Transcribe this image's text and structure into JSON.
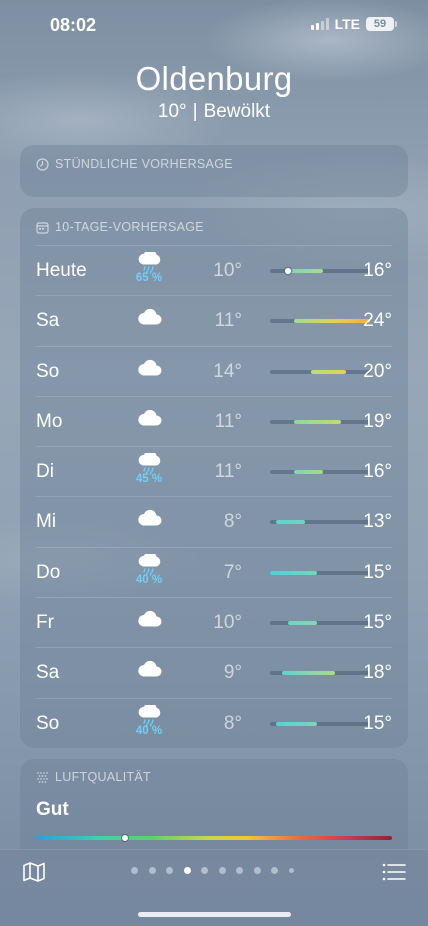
{
  "status_bar": {
    "time": "08:02",
    "network": "LTE",
    "battery": "59"
  },
  "header": {
    "city": "Oldenburg",
    "temperature": "10°",
    "separator": "|",
    "condition": "Bewölkt"
  },
  "hourly": {
    "title": "STÜNDLICHE VORHERSAGE",
    "icon": "clock-icon"
  },
  "daily": {
    "title": "10-TAGE-VORHERSAGE",
    "icon": "calendar-icon",
    "scale_min": 7,
    "scale_max": 24,
    "current_temp": 10,
    "days": [
      {
        "day": "Heute",
        "icon": "cloud-rain-icon",
        "precip": "65 %",
        "low": "10°",
        "high": "16°",
        "low_v": 10,
        "high_v": 16,
        "color": "linear-gradient(90deg,#7fd6b6,#a5dd84)"
      },
      {
        "day": "Sa",
        "icon": "cloud-icon",
        "precip": "",
        "low": "11°",
        "high": "24°",
        "low_v": 11,
        "high_v": 24,
        "color": "linear-gradient(90deg,#9fdc94,#e4d24f,#f2b233)"
      },
      {
        "day": "So",
        "icon": "cloud-icon",
        "precip": "",
        "low": "14°",
        "high": "20°",
        "low_v": 14,
        "high_v": 20,
        "color": "linear-gradient(90deg,#b8dd78,#dfd451)"
      },
      {
        "day": "Mo",
        "icon": "cloud-icon",
        "precip": "",
        "low": "11°",
        "high": "19°",
        "low_v": 11,
        "high_v": 19,
        "color": "linear-gradient(90deg,#8ed8a0,#c0dc6e)"
      },
      {
        "day": "Di",
        "icon": "cloud-rain-icon",
        "precip": "45 %",
        "low": "11°",
        "high": "16°",
        "low_v": 11,
        "high_v": 16,
        "color": "linear-gradient(90deg,#83d6ad,#a2dc88)"
      },
      {
        "day": "Mi",
        "icon": "cloud-icon",
        "precip": "",
        "low": "8°",
        "high": "13°",
        "low_v": 8,
        "high_v": 13,
        "color": "linear-gradient(90deg,#5fd2d0,#6fd6be)"
      },
      {
        "day": "Do",
        "icon": "cloud-rain-icon",
        "precip": "40 %",
        "low": "7°",
        "high": "15°",
        "low_v": 7,
        "high_v": 15,
        "color": "linear-gradient(90deg,#52cfdc,#73d6bb)"
      },
      {
        "day": "Fr",
        "icon": "cloud-icon",
        "precip": "",
        "low": "10°",
        "high": "15°",
        "low_v": 10,
        "high_v": 15,
        "color": "linear-gradient(90deg,#6fd4c4,#85d7b0)"
      },
      {
        "day": "Sa",
        "icon": "cloud-icon",
        "precip": "",
        "low": "9°",
        "high": "18°",
        "low_v": 9,
        "high_v": 18,
        "color": "linear-gradient(90deg,#62d2cf,#a9dc85)"
      },
      {
        "day": "So",
        "icon": "cloud-rain-icon",
        "precip": "40 %",
        "low": "8°",
        "high": "15°",
        "low_v": 8,
        "high_v": 15,
        "color": "linear-gradient(90deg,#58d0d6,#77d6b8)"
      }
    ]
  },
  "air_quality": {
    "title": "LUFTQUALITÄT",
    "icon": "air-quality-icon",
    "status": "Gut",
    "level": 0.25
  },
  "toolbar": {
    "map_icon": "map-icon",
    "list_icon": "list-icon",
    "page_count": 10,
    "active_page": 3
  }
}
